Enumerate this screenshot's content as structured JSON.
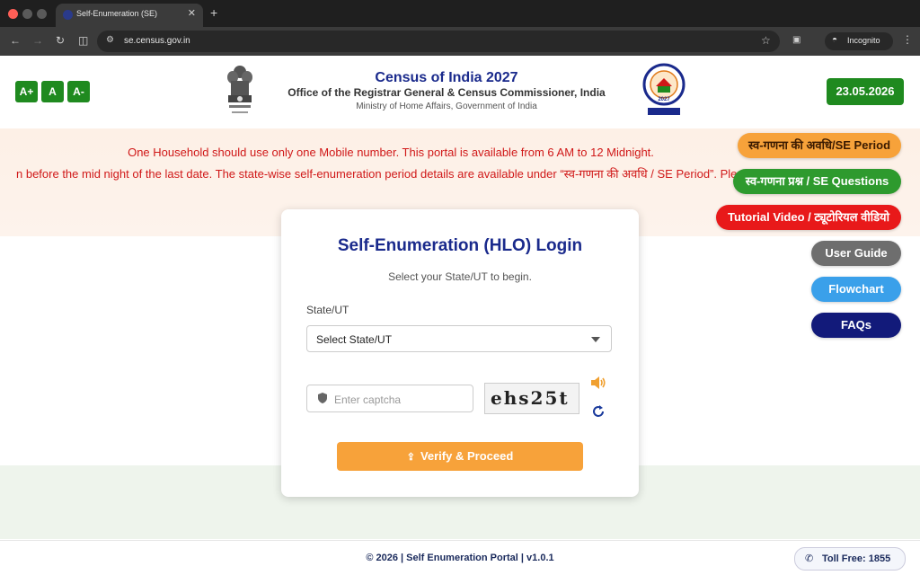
{
  "browser": {
    "tab_title": "Self-Enumeration (SE)",
    "tab_close": "✕",
    "new_tab": "+",
    "url": "se.census.gov.in",
    "incognito_label": "Incognito"
  },
  "header": {
    "font_buttons": [
      "A+",
      "A",
      "A-"
    ],
    "title": "Census of India 2027",
    "subtitle": "Office of the Registrar General & Census Commissioner, India",
    "ministry": "Ministry of Home Affairs, Government of India",
    "census_logo_text": "2027",
    "date": "23.05.2026"
  },
  "notices": {
    "line1": "One Household should use only one Mobile number. This portal is available from 6 AM to 12 Midnight.",
    "line2": "n before the mid night of the last date.          The state-wise self-enumeration period details are available under “स्व-गणना की अवधि / SE Period”. Please complete your"
  },
  "login": {
    "title": "Self-Enumeration (HLO) Login",
    "subtitle": "Select your State/UT to begin.",
    "state_label": "State/UT",
    "state_selected": "Select State/UT",
    "captcha_placeholder": "Enter captcha",
    "captcha_text": "ehs25t",
    "verify_label": "Verify & Proceed"
  },
  "side_buttons": [
    {
      "label": "स्व-गणना की अवधि/SE Period",
      "color": "#f7a23a",
      "text_color": "#3a1a00"
    },
    {
      "label": "स्व-गणना प्रश्न / SE Questions",
      "color": "#2e9a2e",
      "text_color": "#ffffff"
    },
    {
      "label": "Tutorial Video / ट्यूटोरियल वीडियो",
      "color": "#e8191a",
      "text_color": "#ffffff"
    },
    {
      "label": "User Guide",
      "color": "#6e6e6e",
      "text_color": "#ffffff"
    },
    {
      "label": "Flowchart",
      "color": "#3aa0ea",
      "text_color": "#ffffff"
    },
    {
      "label": "FAQs",
      "color": "#121a7a",
      "text_color": "#ffffff"
    }
  ],
  "footer": {
    "copyright": "© 2026 | Self Enumeration Portal | v1.0.1",
    "toll_free": "Toll Free: 1855"
  },
  "colors": {
    "accent_blue": "#1a2a8c",
    "green": "#1f8a1f",
    "notice_red": "#d01818",
    "orange": "#f7a23a"
  }
}
